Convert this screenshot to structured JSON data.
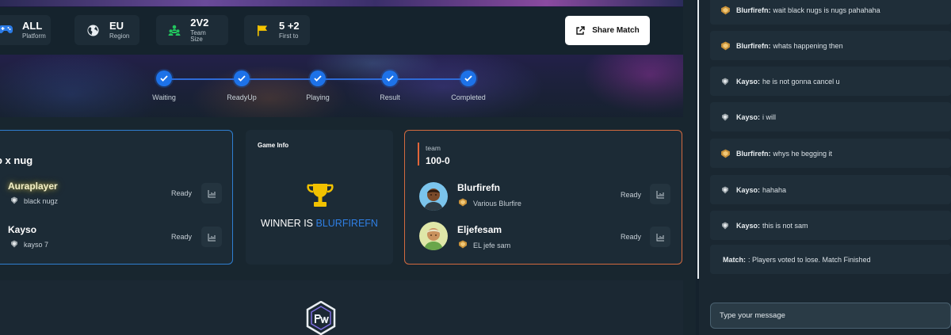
{
  "match_info": {
    "chips": [
      {
        "value": "ALL",
        "label": "Platform",
        "icon": "gamepad-icon"
      },
      {
        "value": "EU",
        "label": "Region",
        "icon": "globe-icon"
      },
      {
        "value": "2V2",
        "label": "Team Size",
        "icon": "team-icon"
      },
      {
        "value": "5 +2",
        "label": "First to",
        "icon": "flag-icon"
      }
    ],
    "share_label": "Share Match"
  },
  "progress": {
    "steps": [
      {
        "label": "Waiting",
        "done": true
      },
      {
        "label": "ReadyUp",
        "done": true
      },
      {
        "label": "Playing",
        "done": true
      },
      {
        "label": "Result",
        "done": true
      },
      {
        "label": "Completed",
        "done": true
      }
    ]
  },
  "left_team": {
    "name": "o x nug",
    "players": [
      {
        "name": "Auraplayer",
        "sub": "black nugz",
        "status": "Ready"
      },
      {
        "name": "Kayso",
        "sub": "kayso 7",
        "status": "Ready"
      }
    ]
  },
  "game_info": {
    "title": "Game Info",
    "winner_prefix": "WINNER IS ",
    "winner_name": "BLURFIREFN"
  },
  "right_team": {
    "label": "team",
    "score": "100-0",
    "players": [
      {
        "name": "Blurfirefn",
        "sub": "Various Blurfire",
        "status": "Ready"
      },
      {
        "name": "Eljefesam",
        "sub": "EL jefe sam",
        "status": "Ready"
      }
    ]
  },
  "chat": {
    "messages": [
      {
        "author": "Blurfirefn:",
        "text": "wait black nugs is nugs pahahaha",
        "badge": "gold-rank-icon"
      },
      {
        "author": "Blurfirefn:",
        "text": "whats happening then",
        "badge": "gold-rank-icon"
      },
      {
        "author": "Kayso:",
        "text": "he is not gonna cancel u",
        "badge": "silver-rank-icon"
      },
      {
        "author": "Kayso:",
        "text": "i will",
        "badge": "silver-rank-icon"
      },
      {
        "author": "Blurfirefn:",
        "text": "whys he begging it",
        "badge": "gold-rank-icon"
      },
      {
        "author": "Kayso:",
        "text": "hahaha",
        "badge": "silver-rank-icon"
      },
      {
        "author": "Kayso:",
        "text": "this is not sam",
        "badge": "silver-rank-icon"
      }
    ],
    "system": {
      "author": "Match:",
      "text": ": Players voted to lose. Match Finished"
    },
    "input_placeholder": "Type your message"
  },
  "colors": {
    "accent_blue": "#1d72e8",
    "winner_blue": "#2f7fe4",
    "left_border": "#2f7fd1",
    "right_border": "#d26a3f"
  }
}
